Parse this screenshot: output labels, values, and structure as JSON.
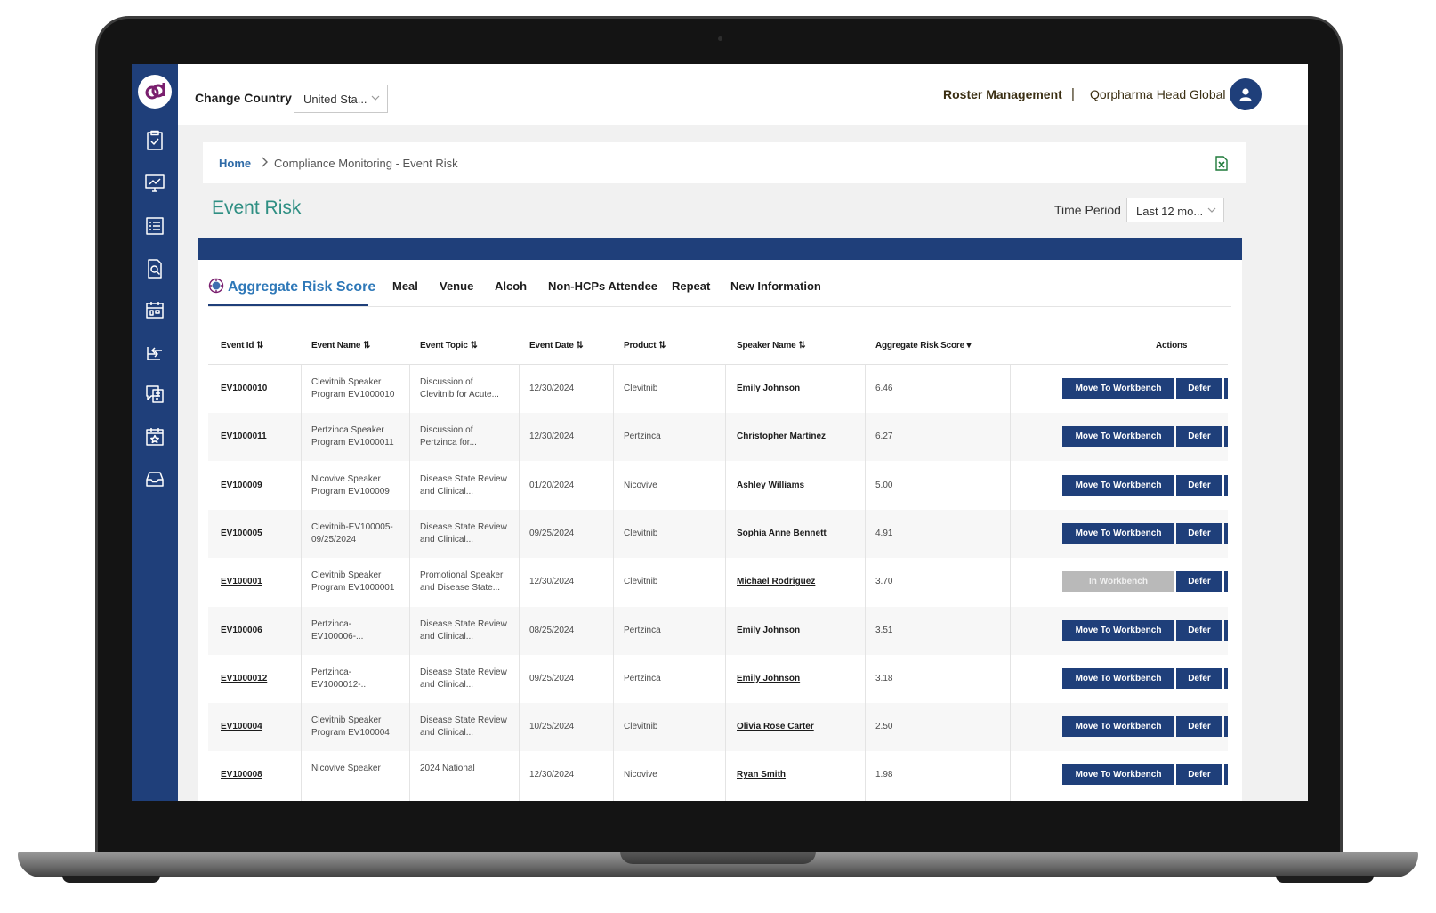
{
  "header": {
    "change_country_label": "Change Country",
    "country_value": "United Sta...",
    "roster_label": "Roster Management",
    "separator": "|",
    "org_name": "Qorpharma Head Global"
  },
  "sidebar": {
    "logo_icon": "qd-logo",
    "items": [
      {
        "icon": "clipboard-check-icon"
      },
      {
        "icon": "monitor-chart-icon"
      },
      {
        "icon": "list-form-icon"
      },
      {
        "icon": "document-search-icon"
      },
      {
        "icon": "calendar-grid-icon"
      },
      {
        "icon": "arrows-transfer-icon"
      },
      {
        "icon": "chat-document-icon"
      },
      {
        "icon": "event-star-icon"
      },
      {
        "icon": "inbox-tray-icon"
      }
    ]
  },
  "breadcrumb": {
    "home": "Home",
    "path": "Compliance Monitoring  -  Event Risk",
    "export_icon": "excel-export-icon"
  },
  "page": {
    "title": "Event Risk",
    "time_period_label": "Time Period",
    "time_period_value": "Last 12 mo..."
  },
  "tabs": [
    {
      "label": "Aggregate Risk Score",
      "active": true
    },
    {
      "label": "Meal"
    },
    {
      "label": "Venue"
    },
    {
      "label": "Alcoh"
    },
    {
      "label": "Non-HCPs Attendee"
    },
    {
      "label": "Repeat"
    },
    {
      "label": "New Information"
    }
  ],
  "table": {
    "columns": [
      "Event Id",
      "Event Name",
      "Event Topic",
      "Event Date",
      "Product",
      "Speaker Name",
      "Aggregate Risk Score",
      "Actions"
    ],
    "rows": [
      {
        "id": "EV1000010",
        "name": [
          "Clevitnib Speaker",
          "Program EV1000010"
        ],
        "topic": [
          "Discussion of",
          "Clevitnib for Acute..."
        ],
        "date": "12/30/2024",
        "product": "Clevitnib",
        "speaker": "Emily Johnson",
        "score": "6.46",
        "action": "Move To Workbench",
        "action_disabled": false,
        "defer": "Defer"
      },
      {
        "id": "EV1000011",
        "name": [
          "Pertzinca Speaker",
          "Program EV1000011"
        ],
        "topic": [
          "Discussion of",
          "Pertzinca for..."
        ],
        "date": "12/30/2024",
        "product": "Pertzinca",
        "speaker": "Christopher Martinez",
        "score": "6.27",
        "action": "Move To Workbench",
        "action_disabled": false,
        "defer": "Defer"
      },
      {
        "id": "EV100009",
        "name": [
          "Nicovive Speaker",
          "Program EV100009"
        ],
        "topic": [
          "Disease State Review",
          "and Clinical..."
        ],
        "date": "01/20/2024",
        "product": "Nicovive",
        "speaker": "Ashley Williams",
        "score": "5.00",
        "action": "Move To Workbench",
        "action_disabled": false,
        "defer": "Defer"
      },
      {
        "id": "EV100005",
        "name": [
          "Clevitnib-EV100005-",
          "09/25/2024"
        ],
        "topic": [
          "Disease State Review",
          "and Clinical..."
        ],
        "date": "09/25/2024",
        "product": "Clevitnib",
        "speaker": "Sophia Anne Bennett",
        "score": "4.91",
        "action": "Move To Workbench",
        "action_disabled": false,
        "defer": "Defer"
      },
      {
        "id": "EV100001",
        "name": [
          "Clevitnib Speaker",
          "Program EV1000001"
        ],
        "topic": [
          "Promotional Speaker",
          "and Disease State..."
        ],
        "date": "12/30/2024",
        "product": "Clevitnib",
        "speaker": "Michael Rodriguez",
        "score": "3.70",
        "action": "In Workbench",
        "action_disabled": true,
        "defer": "Defer"
      },
      {
        "id": "EV100006",
        "name": [
          "Pertzinca-",
          "EV100006-..."
        ],
        "topic": [
          "Disease State Review",
          "and Clinical..."
        ],
        "date": "08/25/2024",
        "product": "Pertzinca",
        "speaker": "Emily Johnson",
        "score": "3.51",
        "action": "Move To Workbench",
        "action_disabled": false,
        "defer": "Defer"
      },
      {
        "id": "EV1000012",
        "name": [
          "Pertzinca-",
          "EV1000012-..."
        ],
        "topic": [
          "Disease State Review",
          "and Clinical..."
        ],
        "date": "09/25/2024",
        "product": "Pertzinca",
        "speaker": "Emily Johnson",
        "score": "3.18",
        "action": "Move To Workbench",
        "action_disabled": false,
        "defer": "Defer"
      },
      {
        "id": "EV100004",
        "name": [
          "Clevitnib Speaker",
          "Program EV100004"
        ],
        "topic": [
          "Disease State Review",
          "and Clinical..."
        ],
        "date": "10/25/2024",
        "product": "Clevitnib",
        "speaker": "Olivia Rose Carter",
        "score": "2.50",
        "action": "Move To Workbench",
        "action_disabled": false,
        "defer": "Defer"
      },
      {
        "id": "EV100008",
        "name": [
          "Nicovive Speaker",
          ""
        ],
        "topic": [
          "2024 National",
          ""
        ],
        "date": "12/30/2024",
        "product": "Nicovive",
        "speaker": "Ryan Smith",
        "score": "1.98",
        "action": "Move To Workbench",
        "action_disabled": false,
        "defer": "Defer"
      }
    ]
  },
  "colors": {
    "brand_navy": "#1f3f7a",
    "title_teal": "#2f8f83",
    "tab_active_blue": "#2e78b8"
  }
}
